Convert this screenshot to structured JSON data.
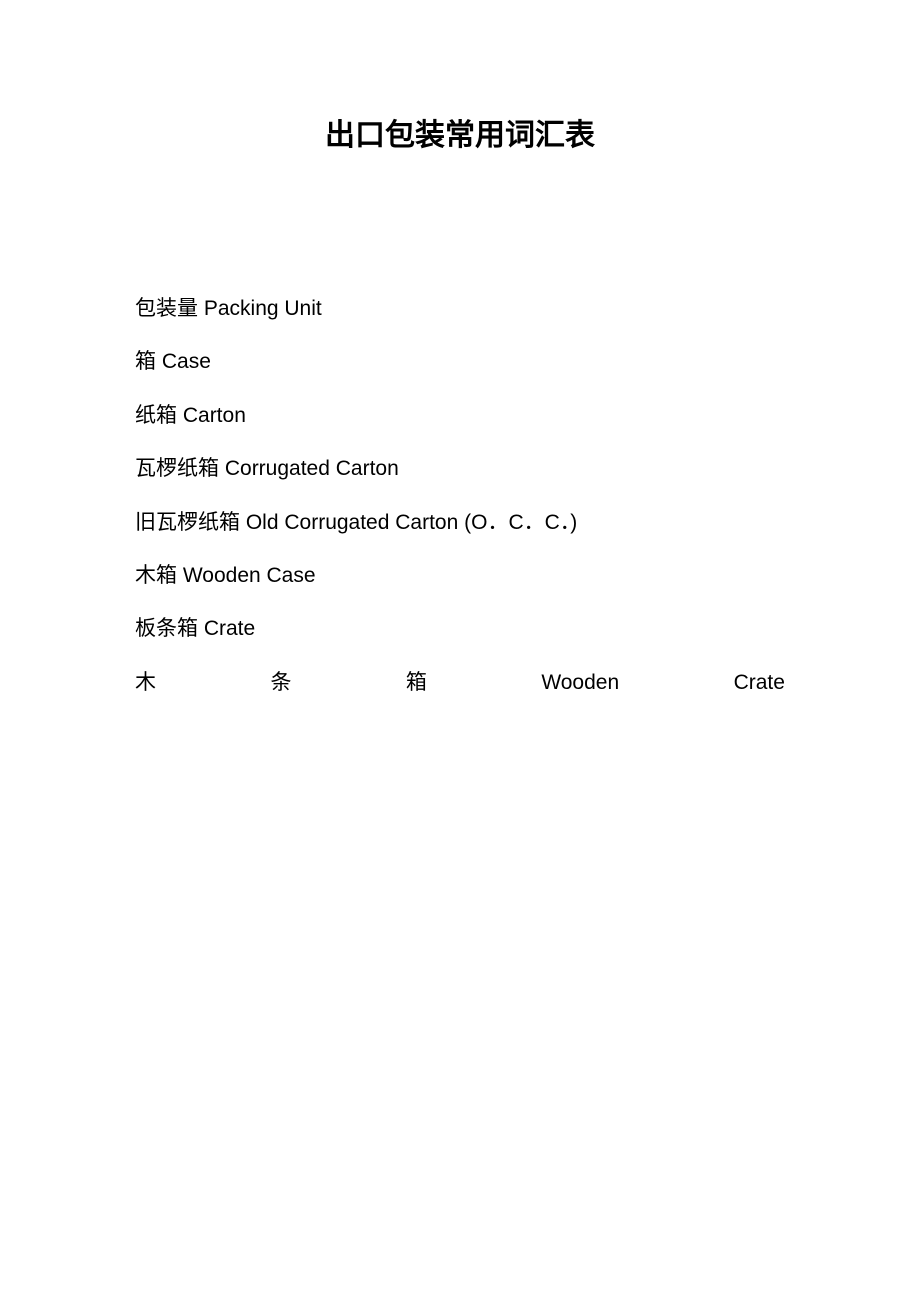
{
  "title": "出口包装常用词汇表",
  "vocab": [
    {
      "cn": "包装量",
      "en": "Packing Unit"
    },
    {
      "cn": "箱",
      "en": "Case"
    },
    {
      "cn": "纸箱",
      "en": "Carton"
    },
    {
      "cn": "瓦椤纸箱",
      "en": "Corrugated Carton"
    },
    {
      "cn": "旧瓦椤纸箱",
      "en": "Old Corrugated Carton (O．C．C．)"
    },
    {
      "cn": "木箱",
      "en": "Wooden Case"
    },
    {
      "cn": "板条箱",
      "en": "Crate"
    }
  ],
  "justified_line": {
    "parts": [
      "木",
      "条",
      "箱",
      "Wooden",
      "Crate"
    ]
  }
}
